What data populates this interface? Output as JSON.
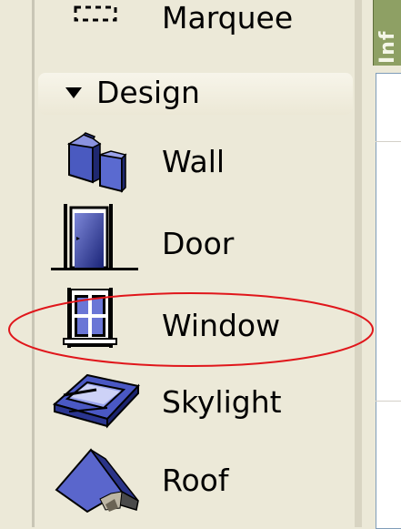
{
  "toolbox": {
    "marquee_label": "Marquee",
    "group_label": "Design",
    "items": [
      {
        "label": "Wall",
        "icon": "wall-icon"
      },
      {
        "label": "Door",
        "icon": "door-icon"
      },
      {
        "label": "Window",
        "icon": "window-icon"
      },
      {
        "label": "Skylight",
        "icon": "skylight-icon"
      },
      {
        "label": "Roof",
        "icon": "roof-icon"
      }
    ]
  },
  "right_panel": {
    "header_text": "Inf"
  },
  "annotation": {
    "highlight_color": "#e0161b",
    "highlighted_item": "Window"
  }
}
